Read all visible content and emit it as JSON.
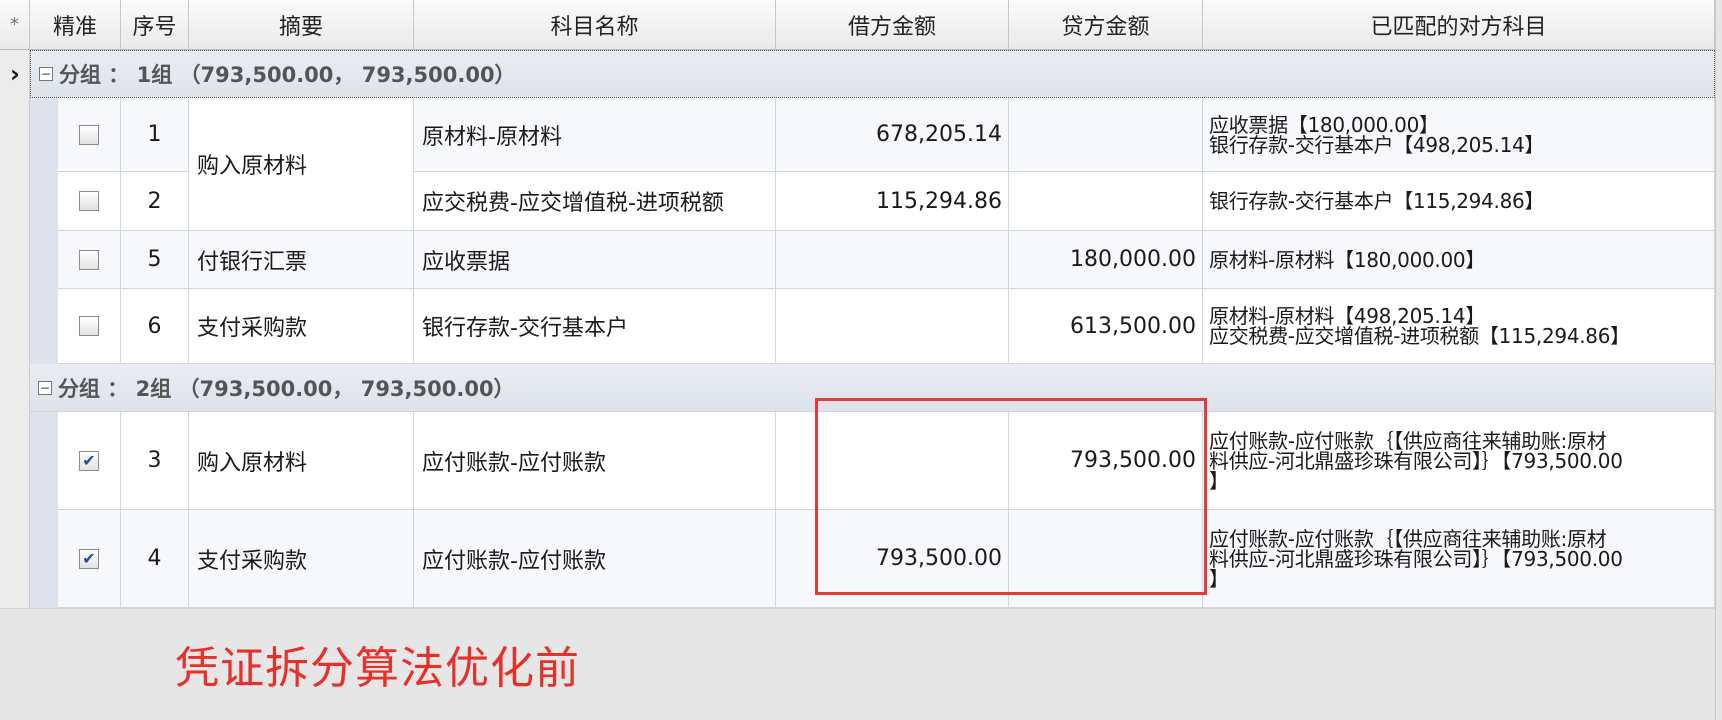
{
  "header": {
    "corner_icon": "*",
    "columns": [
      "精准",
      "序号",
      "摘要",
      "科目名称",
      "借方金额",
      "贷方金额",
      "已匹配的对方科目"
    ]
  },
  "groups": [
    {
      "label": "分组 ： 1组 （793,500.00， 793,500.00）",
      "expanded": true
    },
    {
      "label": "分组 ： 2组 （793,500.00， 793,500.00）",
      "expanded": true
    }
  ],
  "rows": [
    {
      "checked": false,
      "seq": "1",
      "summary": "购入原材料",
      "subject": "原材料-原材料",
      "debit": "678,205.14",
      "credit": "",
      "matched": [
        "应收票据【180,000.00】",
        "银行存款-交行基本户【498,205.14】"
      ]
    },
    {
      "checked": false,
      "seq": "2",
      "summary": "",
      "subject": "应交税费-应交增值税-进项税额",
      "debit": "115,294.86",
      "credit": "",
      "matched": [
        "银行存款-交行基本户【115,294.86】"
      ]
    },
    {
      "checked": false,
      "seq": "5",
      "summary": "付银行汇票",
      "subject": "应收票据",
      "debit": "",
      "credit": "180,000.00",
      "matched": [
        "原材料-原材料【180,000.00】"
      ]
    },
    {
      "checked": false,
      "seq": "6",
      "summary": "支付采购款",
      "subject": "银行存款-交行基本户",
      "debit": "",
      "credit": "613,500.00",
      "matched": [
        "原材料-原材料【498,205.14】",
        "应交税费-应交增值税-进项税额【115,294.86】"
      ]
    },
    {
      "checked": true,
      "seq": "3",
      "summary": "购入原材料",
      "subject": "应付账款-应付账款",
      "debit": "",
      "credit": "793,500.00",
      "matched": [
        "应付账款-应付账款｛【供应商往来辅助账:原材",
        "料供应-河北鼎盛珍珠有限公司】｝【793,500.00",
        "】"
      ]
    },
    {
      "checked": true,
      "seq": "4",
      "summary": "支付采购款",
      "subject": "应付账款-应付账款",
      "debit": "793,500.00",
      "credit": "",
      "matched": [
        "应付账款-应付账款｛【供应商往来辅助账:原材",
        "料供应-河北鼎盛珍珠有限公司】｝【793,500.00",
        "】"
      ]
    }
  ],
  "checkmark_glyph": "✔",
  "annotation": {
    "note": "凭证拆分算法优化前",
    "color": "#e8302b"
  }
}
